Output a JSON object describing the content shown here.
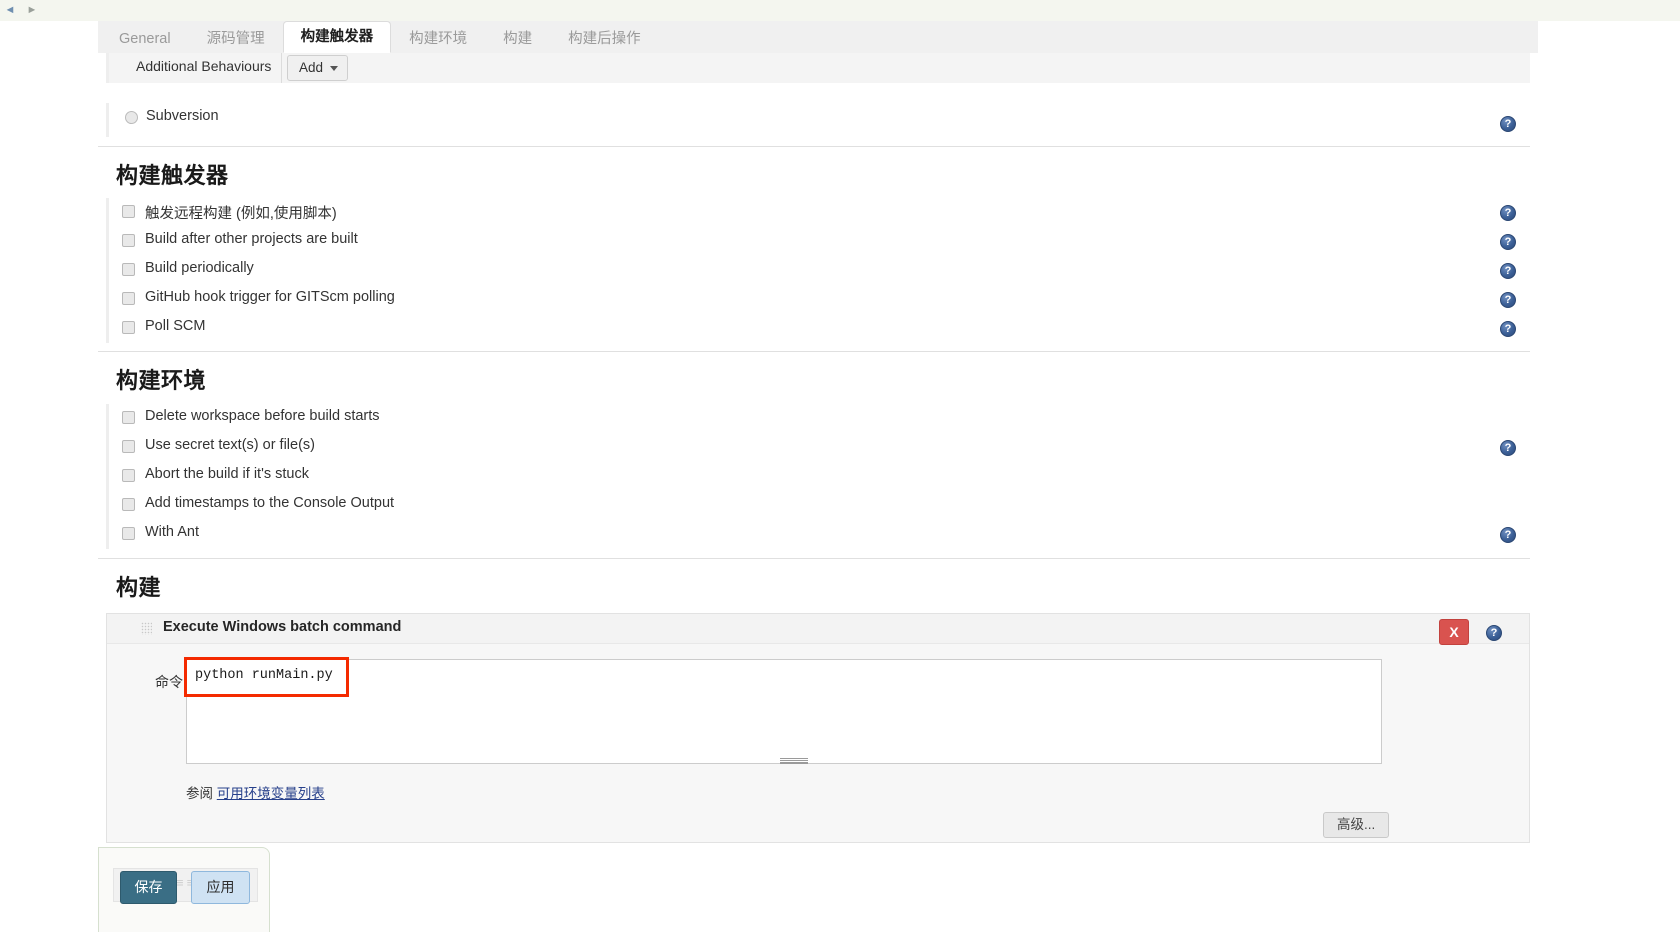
{
  "browser": {
    "back_icon": "back-arrow-icon",
    "forward_icon": "forward-arrow-icon"
  },
  "tabs": [
    {
      "label": "General",
      "active": false
    },
    {
      "label": "源码管理",
      "active": false
    },
    {
      "label": "构建触发器",
      "active": true
    },
    {
      "label": "构建环境",
      "active": false
    },
    {
      "label": "构建",
      "active": false
    },
    {
      "label": "构建后操作",
      "active": false
    }
  ],
  "scm_tail": {
    "additional_behaviours_label": "Additional Behaviours",
    "add_button_label": "Add",
    "add_caret_icon": "chevron-down-icon",
    "subversion_label": "Subversion",
    "subversion_radio": "radio-unselected-icon",
    "help_icon": "help-icon"
  },
  "sections": {
    "build_triggers": {
      "title": "构建触发器",
      "items": [
        {
          "label": "触发远程构建 (例如,使用脚本)",
          "checked": false,
          "help": true
        },
        {
          "label": "Build after other projects are built",
          "checked": false,
          "help": true
        },
        {
          "label": "Build periodically",
          "checked": false,
          "help": true
        },
        {
          "label": "GitHub hook trigger for GITScm polling",
          "checked": false,
          "help": true
        },
        {
          "label": "Poll SCM",
          "checked": false,
          "help": true
        }
      ]
    },
    "build_environment": {
      "title": "构建环境",
      "items": [
        {
          "label": "Delete workspace before build starts",
          "checked": false,
          "help": false
        },
        {
          "label": "Use secret text(s) or file(s)",
          "checked": false,
          "help": true
        },
        {
          "label": "Abort the build if it's stuck",
          "checked": false,
          "help": false
        },
        {
          "label": "Add timestamps to the Console Output",
          "checked": false,
          "help": false
        },
        {
          "label": "With Ant",
          "checked": false,
          "help": true
        }
      ]
    },
    "build": {
      "title": "构建",
      "builder": {
        "title": "Execute Windows batch command",
        "grip_icon": "drag-handle-icon",
        "delete_label": "X",
        "help_icon": "help-icon",
        "command_label": "命令",
        "command_value": "python runMain.py",
        "resize_grip_icon": "resize-grip-icon",
        "see_also_prefix": "参阅",
        "see_also_link": "可用环境变量列表",
        "advanced_label": "高级..."
      }
    }
  },
  "footer": {
    "save_label": "保存",
    "apply_label": "应用"
  },
  "colors": {
    "accent": "#3a6e85",
    "apply": "#cfe2f3",
    "danger": "#d9534f",
    "highlight": "#f42a00",
    "help": "#3b5f96",
    "link": "#27408b"
  }
}
